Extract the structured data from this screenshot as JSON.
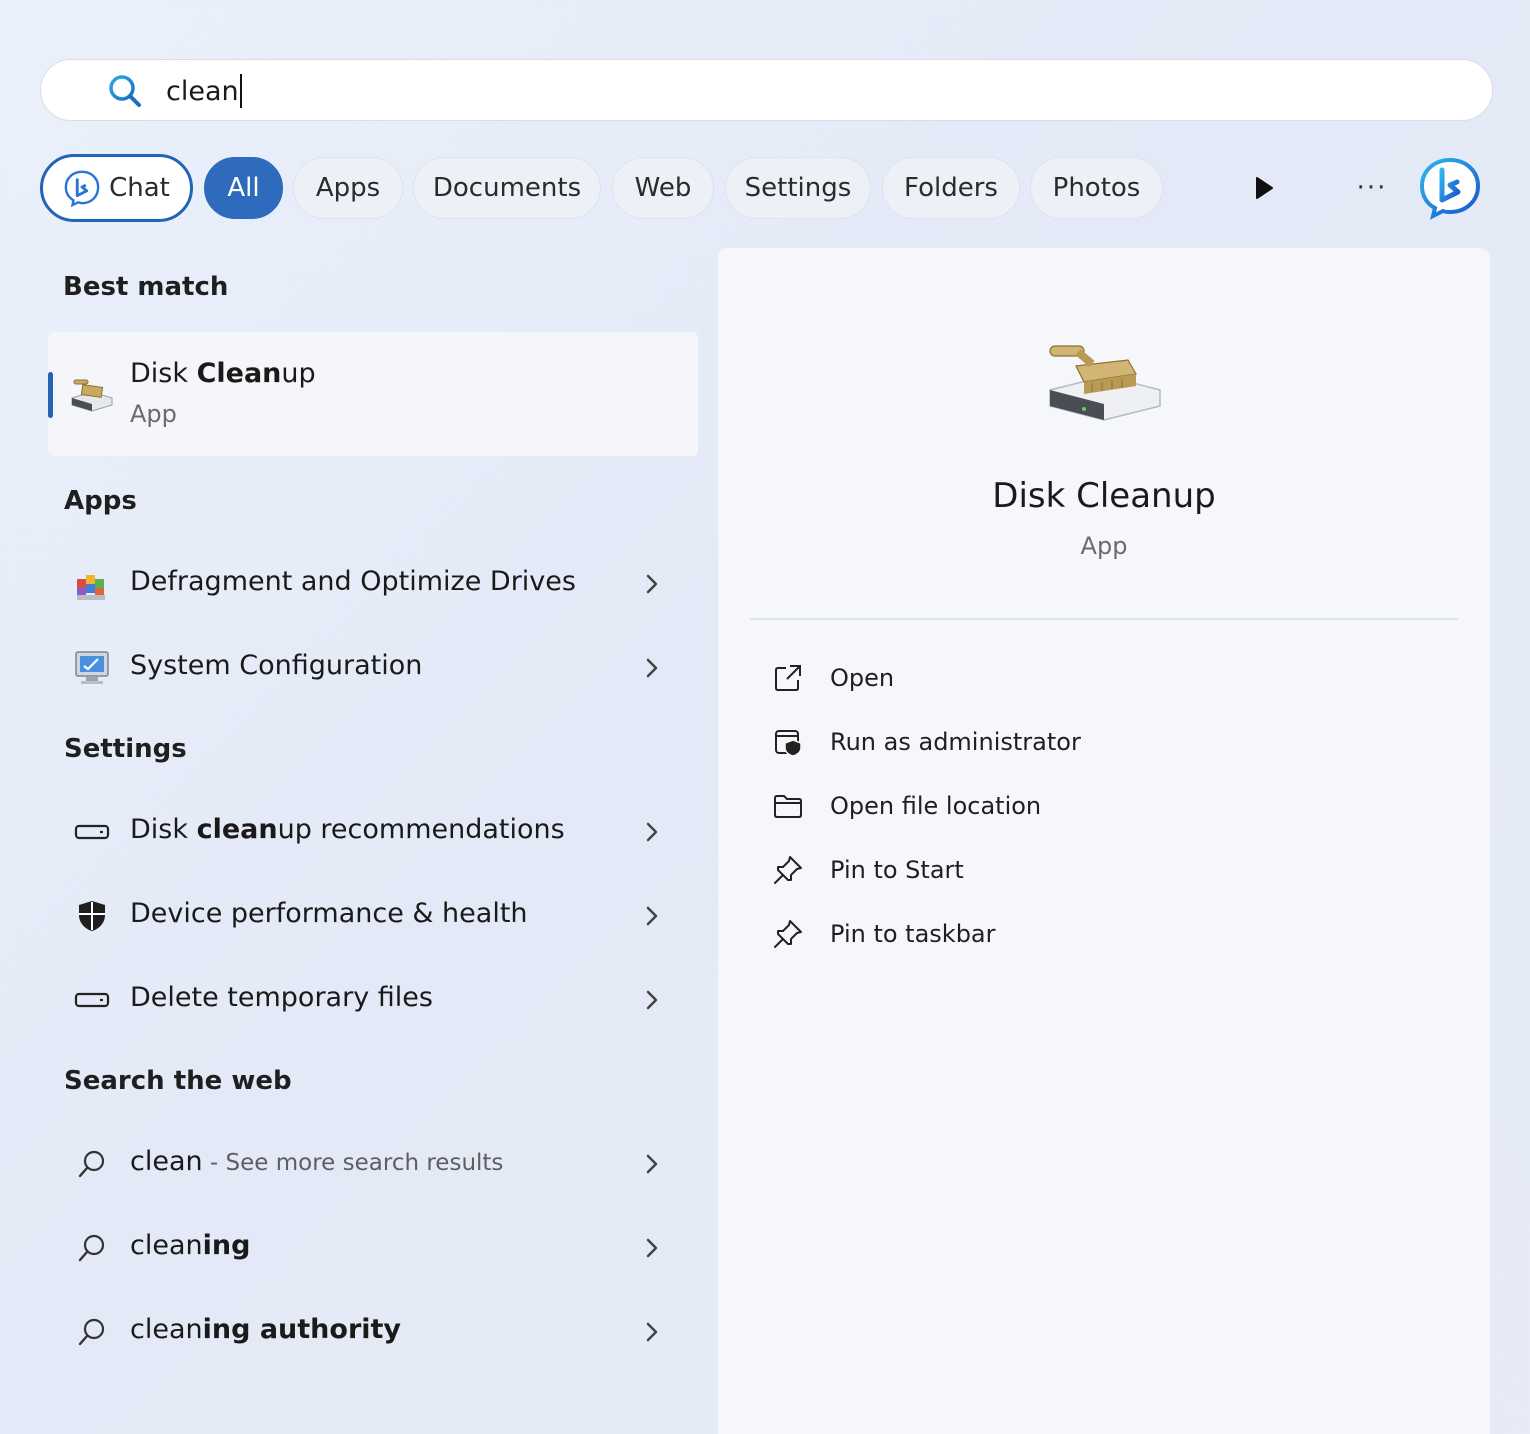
{
  "search": {
    "query": "clean"
  },
  "filters": {
    "chat": "Chat",
    "all": "All",
    "apps": "Apps",
    "documents": "Documents",
    "web": "Web",
    "settings": "Settings",
    "folders": "Folders",
    "photos": "Photos",
    "more": "···"
  },
  "sections": {
    "best_match": "Best match",
    "apps": "Apps",
    "settings": "Settings",
    "search_web": "Search the web"
  },
  "best_match": {
    "title_pre": "Disk ",
    "title_bold": "Clean",
    "title_post": "up",
    "subtitle": "App"
  },
  "apps": [
    {
      "label": "Defragment and Optimize Drives"
    },
    {
      "label": "System Configuration"
    }
  ],
  "settings": [
    {
      "pre": "Disk ",
      "bold": "clean",
      "post": "up recommendations"
    },
    {
      "pre": "Device performance & health",
      "bold": "",
      "post": ""
    },
    {
      "pre": "Delete temporary files",
      "bold": "",
      "post": ""
    }
  ],
  "web": [
    {
      "pre": "clean",
      "bold": "",
      "post": "",
      "muted": " - See more search results"
    },
    {
      "pre": "clean",
      "bold": "ing",
      "post": "",
      "muted": ""
    },
    {
      "pre": "clean",
      "bold": "ing authority",
      "post": "",
      "muted": ""
    }
  ],
  "preview": {
    "title": "Disk Cleanup",
    "subtitle": "App",
    "actions": [
      {
        "label": "Open",
        "icon": "open-external-icon"
      },
      {
        "label": "Run as administrator",
        "icon": "shield-admin-icon"
      },
      {
        "label": "Open file location",
        "icon": "folder-icon"
      },
      {
        "label": "Pin to Start",
        "icon": "pin-icon"
      },
      {
        "label": "Pin to taskbar",
        "icon": "pin-icon"
      }
    ]
  },
  "colors": {
    "accent": "#2463b8",
    "chip_selected": "#2f6bbd"
  }
}
